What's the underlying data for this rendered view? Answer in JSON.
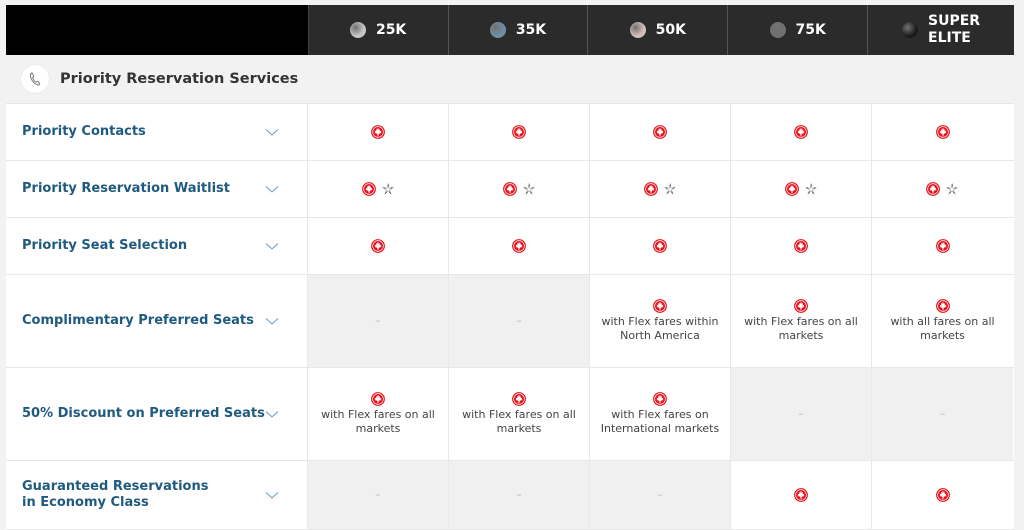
{
  "header": {
    "tiers": [
      {
        "label": "25K",
        "badge_color": "#c8c8c8"
      },
      {
        "label": "35K",
        "badge_color": "#6e8fa6"
      },
      {
        "label": "50K",
        "badge_color": "#d8c0bc"
      },
      {
        "label": "75K",
        "badge_color": "#707070"
      },
      {
        "label": "SUPER\nELITE",
        "badge_color": "#1a1a1a"
      }
    ]
  },
  "section": {
    "icon": "phone-icon",
    "title": "Priority Reservation Services"
  },
  "rows": [
    {
      "label": "Priority Contacts",
      "cells": [
        {
          "available": true,
          "star_alliance": false,
          "note": ""
        },
        {
          "available": true,
          "star_alliance": false,
          "note": ""
        },
        {
          "available": true,
          "star_alliance": false,
          "note": ""
        },
        {
          "available": true,
          "star_alliance": false,
          "note": ""
        },
        {
          "available": true,
          "star_alliance": false,
          "note": ""
        }
      ]
    },
    {
      "label": "Priority Reservation Waitlist",
      "cells": [
        {
          "available": true,
          "star_alliance": true,
          "note": ""
        },
        {
          "available": true,
          "star_alliance": true,
          "note": ""
        },
        {
          "available": true,
          "star_alliance": true,
          "note": ""
        },
        {
          "available": true,
          "star_alliance": true,
          "note": ""
        },
        {
          "available": true,
          "star_alliance": true,
          "note": ""
        }
      ]
    },
    {
      "label": "Priority Seat Selection",
      "cells": [
        {
          "available": true,
          "star_alliance": false,
          "note": ""
        },
        {
          "available": true,
          "star_alliance": false,
          "note": ""
        },
        {
          "available": true,
          "star_alliance": false,
          "note": ""
        },
        {
          "available": true,
          "star_alliance": false,
          "note": ""
        },
        {
          "available": true,
          "star_alliance": false,
          "note": ""
        }
      ]
    },
    {
      "label": "Complimentary Preferred Seats",
      "cells": [
        {
          "available": false,
          "note": "–"
        },
        {
          "available": false,
          "note": "–"
        },
        {
          "available": true,
          "star_alliance": false,
          "note": "with Flex fares within North America"
        },
        {
          "available": true,
          "star_alliance": false,
          "note": "with Flex fares on all markets"
        },
        {
          "available": true,
          "star_alliance": false,
          "note": "with all fares on all markets"
        }
      ]
    },
    {
      "label": "50% Discount on Preferred Seats",
      "cells": [
        {
          "available": true,
          "star_alliance": false,
          "note": "with Flex fares on all markets"
        },
        {
          "available": true,
          "star_alliance": false,
          "note": "with Flex fares on all markets"
        },
        {
          "available": true,
          "star_alliance": false,
          "note": "with Flex fares on International markets"
        },
        {
          "available": false,
          "note": "–"
        },
        {
          "available": false,
          "note": "–"
        }
      ]
    },
    {
      "label": "Guaranteed Reservations\nin Economy Class",
      "cells": [
        {
          "available": false,
          "note": "–"
        },
        {
          "available": false,
          "note": "–"
        },
        {
          "available": false,
          "note": "–"
        },
        {
          "available": true,
          "star_alliance": false,
          "note": ""
        },
        {
          "available": true,
          "star_alliance": false,
          "note": ""
        }
      ]
    }
  ],
  "colors": {
    "accent_red": "#e8101a",
    "label_blue": "#1f5a80",
    "header_bg": "#2b2b2b"
  }
}
